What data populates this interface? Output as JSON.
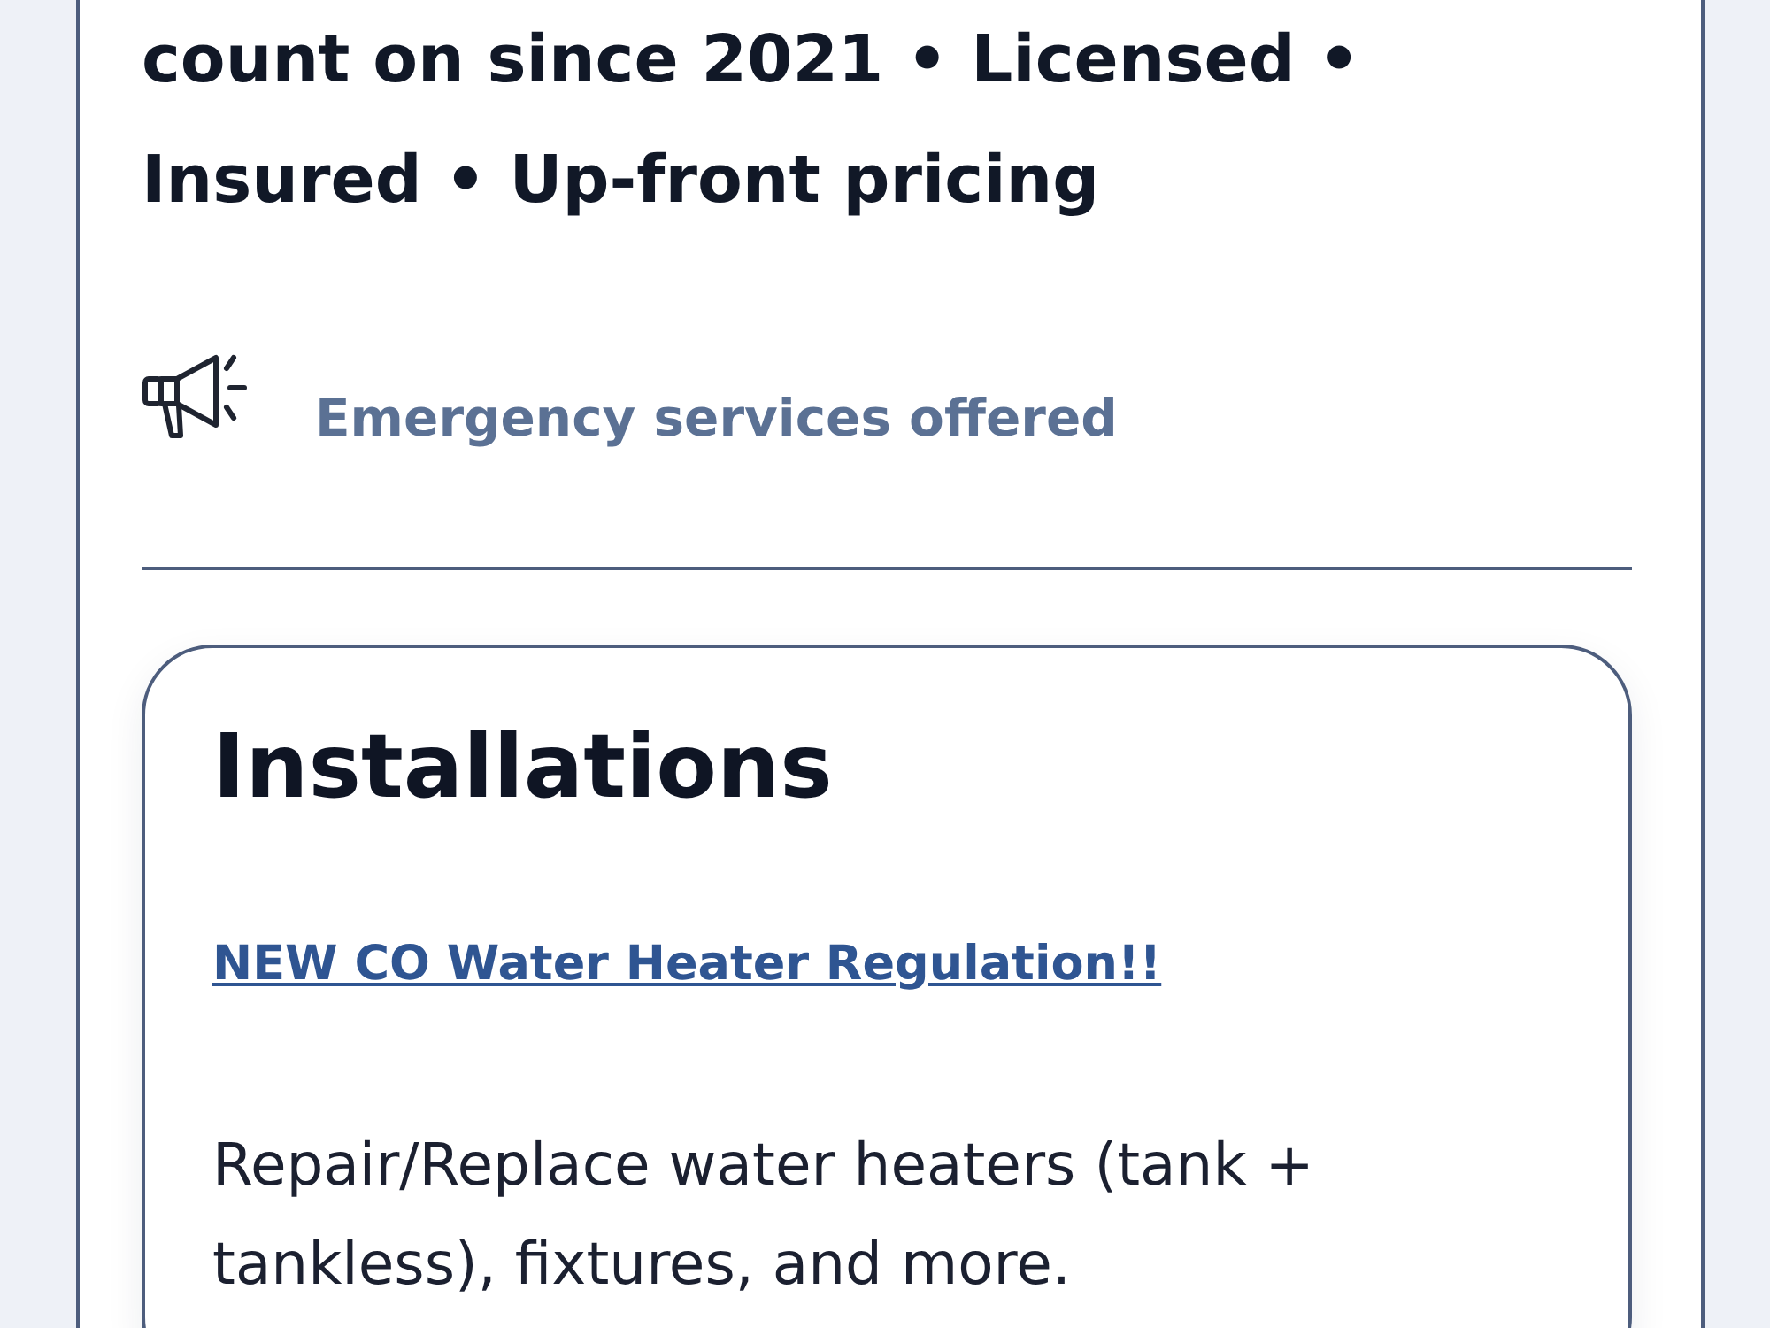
{
  "intro": {
    "text": "count on since 2021 • Licensed • Insured • Up-front pricing"
  },
  "notice": {
    "text": "Emergency services offered"
  },
  "service_card": {
    "title": "Installations",
    "link": "NEW CO Water Heater Regulation!!",
    "description": "Repair/Replace water heaters (tank + tankless), fixtures, and more."
  }
}
